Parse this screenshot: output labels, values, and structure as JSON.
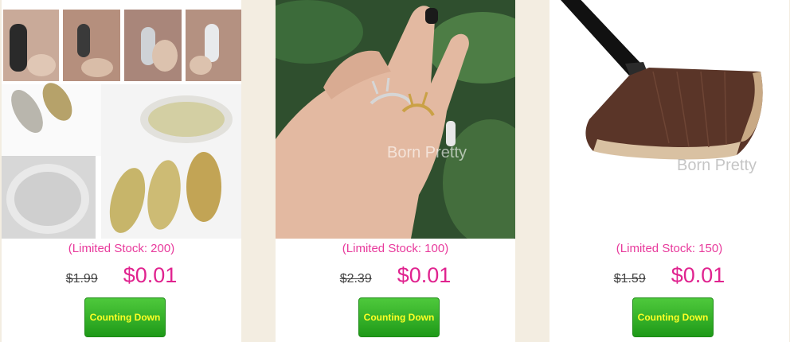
{
  "products": [
    {
      "name": "chrome-powder",
      "stock_label": "(Limited Stock: 200)",
      "old_price": "$1.99",
      "new_price": "$0.01",
      "button_label": "Counting Down",
      "watermark": ""
    },
    {
      "name": "antler-ring",
      "stock_label": "(Limited Stock: 100)",
      "old_price": "$2.39",
      "new_price": "$0.01",
      "button_label": "Counting Down",
      "watermark": "Born Pretty"
    },
    {
      "name": "fan-brush",
      "stock_label": "(Limited Stock: 150)",
      "old_price": "$1.59",
      "new_price": "$0.01",
      "button_label": "Counting Down",
      "watermark": "Born Pretty"
    }
  ],
  "colors": {
    "stock_text": "#e83a9c",
    "sale_price": "#e0238f",
    "button_green": "#2fb023",
    "button_text": "#ffff26",
    "page_bg": "#f3ede1"
  }
}
